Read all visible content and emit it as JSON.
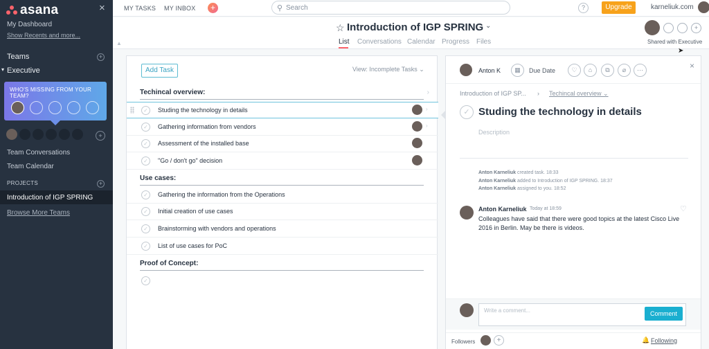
{
  "sidebar": {
    "logo_text": "asana",
    "close_icon": "×",
    "my_dashboard": "My Dashboard",
    "show_recents": "Show Recents and more...",
    "teams_header": "Teams",
    "team_name": "Executive",
    "popup_title": "WHO'S MISSING FROM YOUR TEAM?",
    "team_conversations": "Team Conversations",
    "team_calendar": "Team Calendar",
    "projects_header": "PROJECTS",
    "active_project": "Introduction of IGP SPRING",
    "browse_teams": "Browse More Teams",
    "plus": "+",
    "team_caret": "▾"
  },
  "topbar": {
    "my_tasks": "MY TASKS",
    "my_inbox": "MY INBOX",
    "plus": "+",
    "search_placeholder": "Search",
    "search_icon": "⚲",
    "help": "?",
    "upgrade": "Upgrade",
    "account": "karneliuk.com"
  },
  "project": {
    "star": "☆",
    "title": "Introduction of IGP SPRING",
    "caret": "⌄",
    "tabs": [
      "List",
      "Conversations",
      "Calendar",
      "Progress",
      "Files"
    ],
    "shared_with": "Shared with Executive",
    "collapse": "▲",
    "member_add": "+"
  },
  "tasklist": {
    "add_task": "Add Task",
    "view": "View: Incomplete Tasks ⌄",
    "check": "✓",
    "chevron": "›",
    "sections": [
      {
        "title": "Techincal overview:"
      },
      {
        "title": "Use cases:"
      },
      {
        "title": "Proof of Concept:"
      }
    ],
    "tasks": [
      "Studing the technology in details",
      "Gathering information from vendors",
      "Assessment of the installed base",
      "\"Go / don't go\" decision",
      "Gathering the information from the Operations",
      "Initial creation of use cases",
      "Brainstorming with vendors and operations",
      "List of use cases for PoC"
    ]
  },
  "detail": {
    "assignee": "Anton K",
    "calendar_icon": "▦",
    "due_date": "Due Date",
    "icons": [
      "♡",
      "⌂",
      "⧉",
      "⌀",
      "⋯"
    ],
    "close": "×",
    "breadcrumb_project": "Introduction of IGP SP...",
    "breadcrumb_sep": "›",
    "breadcrumb_section": "Techincal overview ⌄",
    "check": "✓",
    "title": "Studing the technology in details",
    "description_placeholder": "Description",
    "activity": [
      {
        "who": "Anton Karneliuk",
        "what": "created task.",
        "time": "18:33"
      },
      {
        "who": "Anton Karneliuk",
        "what": "added to Introduction of IGP SPRING.",
        "time": "18:37"
      },
      {
        "who": "Anton Karneliuk",
        "what": "assigned to you.",
        "time": "18:52"
      }
    ],
    "comment": {
      "author": "Anton Karneliuk",
      "time": "Today at 18:59",
      "heart": "♡",
      "text": "Colleagues have said that there were good topics at the latest Cisco Live 2016 in Berlin. May be there is videos."
    },
    "composer_placeholder": "Write a comment...",
    "comment_button": "Comment",
    "followers_label": "Followers",
    "add_follower": "+",
    "bell": "🔔",
    "following": "Following"
  }
}
